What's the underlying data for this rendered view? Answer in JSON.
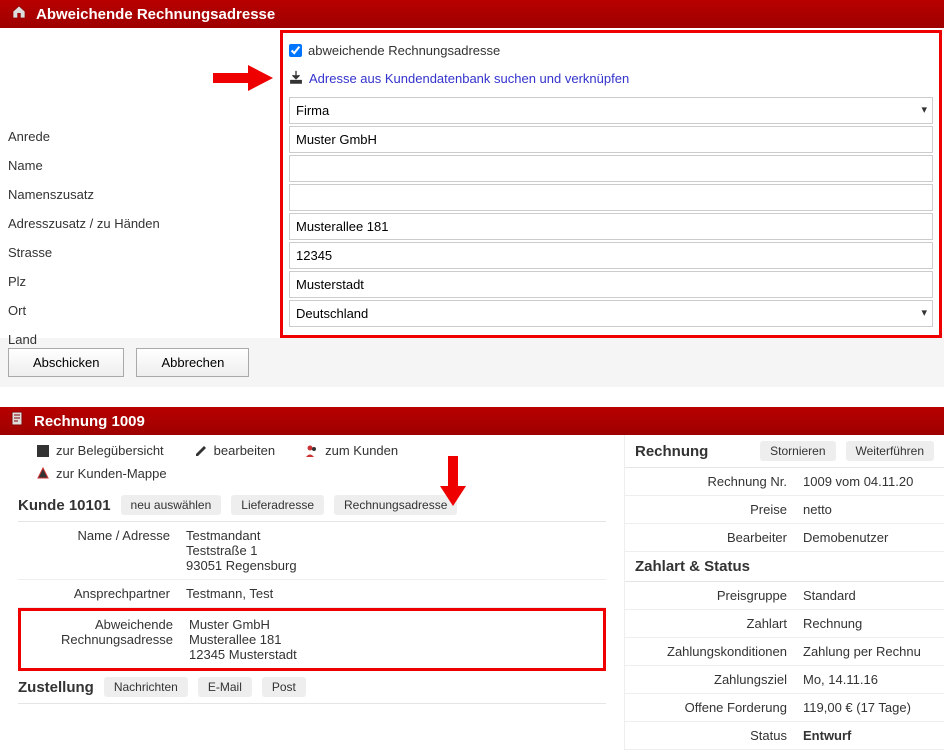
{
  "header1": {
    "title": "Abweichende Rechnungsadresse"
  },
  "form": {
    "cb_label": "abweichende Rechnungsadresse",
    "link_label": "Adresse aus Kundendatenbank suchen und verknüpfen",
    "labels": {
      "anrede": "Anrede",
      "name": "Name",
      "namenszusatz": "Namenszusatz",
      "adresszusatz": "Adresszusatz / zu Händen",
      "strasse": "Strasse",
      "plz": "Plz",
      "ort": "Ort",
      "land": "Land"
    },
    "values": {
      "anrede": "Firma",
      "name": "Muster GmbH",
      "namenszusatz": "",
      "adresszusatz": "",
      "strasse": "Musterallee 181",
      "plz": "12345",
      "ort": "Musterstadt",
      "land": "Deutschland"
    },
    "btn_submit": "Abschicken",
    "btn_cancel": "Abbrechen"
  },
  "header2": {
    "title": "Rechnung 1009"
  },
  "toolbar": {
    "beleg": "zur Belegübersicht",
    "bearbeiten": "bearbeiten",
    "kunden": "zum Kunden",
    "mappe": "zur Kunden-Mappe"
  },
  "kunde": {
    "title": "Kunde 10101",
    "pills": {
      "neu": "neu auswählen",
      "liefer": "Lieferadresse",
      "rechnung": "Rechnungsadresse"
    },
    "rows": {
      "name_label": "Name / Adresse",
      "name_val": "Testmandant\nTeststraße 1\n93051 Regensburg",
      "ansprech_label": "Ansprechpartner",
      "ansprech_val": "Testmann, Test",
      "abw_label": "Abweichende Rechnungsadresse",
      "abw_val": "Muster GmbH\nMusterallee 181\n12345 Musterstadt"
    }
  },
  "zustellung": {
    "title": "Zustellung",
    "pills": {
      "nachrichten": "Nachrichten",
      "email": "E-Mail",
      "post": "Post"
    }
  },
  "rechnung": {
    "title": "Rechnung",
    "pills": {
      "storno": "Stornieren",
      "weiter": "Weiterführen"
    },
    "rows": {
      "nr_label": "Rechnung Nr.",
      "nr_val": "1009 vom 04.11.20",
      "preise_label": "Preise",
      "preise_val": "netto",
      "bearb_label": "Bearbeiter",
      "bearb_val": "Demobenutzer"
    }
  },
  "zahlart": {
    "title": "Zahlart & Status",
    "rows": {
      "pg_label": "Preisgruppe",
      "pg_val": "Standard",
      "za_label": "Zahlart",
      "za_val": "Rechnung",
      "zk_label": "Zahlungskonditionen",
      "zk_val": "Zahlung per Rechnu",
      "zz_label": "Zahlungsziel",
      "zz_val": "Mo, 14.11.16",
      "of_label": "Offene Forderung",
      "of_val": "119,00 € (17 Tage)",
      "st_label": "Status",
      "st_val": "Entwurf"
    }
  }
}
